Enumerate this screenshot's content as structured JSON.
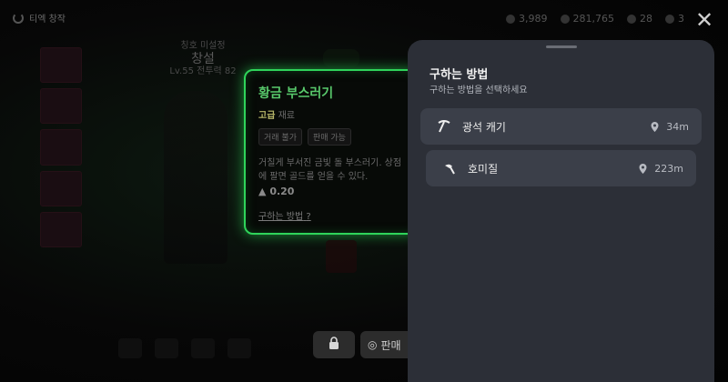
{
  "top_left": {
    "label": "티엑 창작"
  },
  "currency": [
    {
      "icon": "gem-icon",
      "value": "3,989"
    },
    {
      "icon": "coin-icon",
      "value": "281,765"
    },
    {
      "icon": "diamond-icon",
      "value": "28"
    },
    {
      "icon": "ticket-icon",
      "value": "3"
    }
  ],
  "character": {
    "title_small": "칭호 미설정",
    "name": "창설",
    "level": "Lv.55 전투력 82"
  },
  "item": {
    "name": "황금 부스러기",
    "grade": "고급",
    "material": "재료",
    "tags": [
      "거래 불가",
      "판매 가능"
    ],
    "description": "거칠게 부서진 금빛 돌 부스러기. 상점에 팔면 골드를 얻을 수 있다.",
    "weight": "0.20",
    "how_to_get": "구하는 방법"
  },
  "bottom": {
    "sell_label": "판매"
  },
  "sheet": {
    "title": "구하는 방법",
    "subtitle": "구하는 방법을 선택하세요",
    "options": [
      {
        "icon": "pickaxe-icon",
        "label": "광석 캐기",
        "distance": "34m"
      },
      {
        "icon": "hoe-icon",
        "label": "호미질",
        "distance": "223m"
      }
    ]
  },
  "colors": {
    "card_glow": "#2fd45a",
    "sheet_bg": "#2c2f37",
    "option_bg": "#3b3f49"
  }
}
